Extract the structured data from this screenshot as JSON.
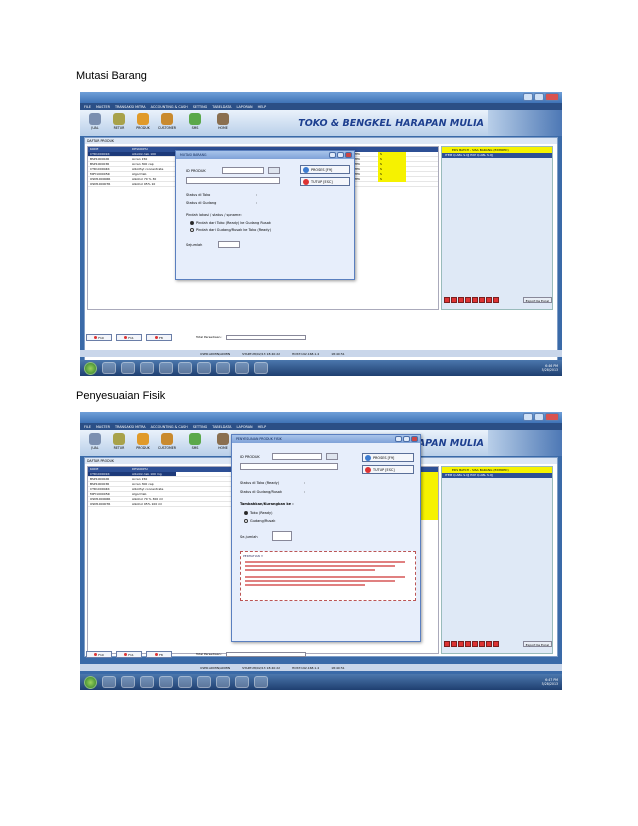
{
  "captions": {
    "first": "Mutasi Barang",
    "second": "Penyesuaian Fisik"
  },
  "app": {
    "brand": "TOKO & BENGKEL HARAPAN MULIA",
    "menu": [
      "FILE",
      "MASTER",
      "TRANSAKSI MITRA",
      "ACCOUNTING & CASH",
      "SETTING",
      "TABELDATA",
      "LAPORAN",
      "HELP"
    ],
    "toolbar": [
      {
        "label": "JUAL",
        "color": "#7b8fb0"
      },
      {
        "label": "RETUR",
        "color": "#a8a24a"
      },
      {
        "label": "PRODUK",
        "color": "#e09a2a"
      },
      {
        "label": "CUSTOMER",
        "color": "#c98a2e"
      },
      {
        "label": "SMS",
        "color": "#5aa84a"
      },
      {
        "label": "HOME",
        "color": "#8a6f4f"
      }
    ],
    "list_title": "DAFTAR PRODUK",
    "grid_headers": [
      "KODE",
      "DESKRIPSI"
    ],
    "right_panel_title": "EDS BATCH - SISA BARANG (EXPIRED)",
    "right_panel_header": "ITEM          Q.ABL   S.QJ   EXP   Q.ABL   S.QJ",
    "export_label": "Export Ke Excel",
    "bottom_buttons": [
      "F10",
      "F11",
      "F8"
    ],
    "total_label": "Total Persediaan :",
    "status_bar": [
      "USER:ADMIN/ADMIN",
      "START:28/02/13 18:40:22",
      "HOST:192.168.1.4",
      "18:40:51"
    ],
    "clock": {
      "time": "6:46 PM",
      "date": "5/28/2013"
    }
  },
  "shot1": {
    "rows": [
      {
        "code": "CTR100001R",
        "desc": "Albiotin tab 100"
      },
      {
        "code": "BSP100002R",
        "desc": "Acran 150"
      },
      {
        "code": "BSP100003R",
        "desc": "Acran 300 cap"
      },
      {
        "code": "CTR100004R",
        "desc": "Albothyl concentrate"
      },
      {
        "code": "MPY100005R",
        "desc": "Algod tab"
      },
      {
        "code": "OSM100006R",
        "desc": "Alkohol 70 % 30"
      },
      {
        "code": "OSM100007R",
        "desc": "Alkohol 95% 10"
      }
    ],
    "side": [
      "OTEK",
      "OTEK",
      "OTEK",
      "OTEK",
      "OTEK",
      "OTEK"
    ],
    "side_val": "S",
    "dialog": {
      "title": "MUTASI BARANG",
      "id_label": "ID PRODUK",
      "status_toko": "Status di Toko",
      "status_gudang": "Status di Gudang",
      "colon": ":",
      "pindah_label": "Pindah lokasi / status / spname:",
      "opt1": "Pindah dari Toko (Ready) ke Gudang Rusak",
      "opt2": "Pindah dari Gudang/Rusak ke Toko (Ready)",
      "jumlah": "Sejumlah",
      "proses": "PROSES [F9]",
      "tutup": "TUTUP [ESC]"
    }
  },
  "shot2": {
    "rows": [
      {
        "code": "CTR100001R",
        "desc": "Albiotin tab 100 mg"
      },
      {
        "code": "BSP100002R",
        "desc": "Acran 150"
      },
      {
        "code": "BSP100003R",
        "desc": "Acran 300 cap"
      },
      {
        "code": "CTR100004R",
        "desc": "Albothyl concentrate"
      },
      {
        "code": "MPY100005R",
        "desc": "Algod tab"
      },
      {
        "code": "OSM100006R",
        "desc": "Alkohol 70 % 300 ml"
      },
      {
        "code": "OSM100007R",
        "desc": "Alkohol 95% 100 ml"
      }
    ],
    "dialog": {
      "title": "PENYESUAIAN PRODUK FISIK",
      "id_label": "ID PRODUK",
      "status_toko": "Status di Toko (Ready)",
      "status_gudang": "Status di Gudang/Rusak",
      "colon": ":",
      "tambah_label": "Tambahkan/Kurangkan ke :",
      "opt1": "Toko (Ready)",
      "opt2": "Gudang/Rusak",
      "jumlah": "Se-jumlah",
      "notes_title": "PERHATIAN !!",
      "proses": "PROSES [F9]",
      "tutup": "TUTUP [ESC]"
    },
    "clock": {
      "time": "6:47 PM",
      "date": "5/28/2013"
    }
  }
}
